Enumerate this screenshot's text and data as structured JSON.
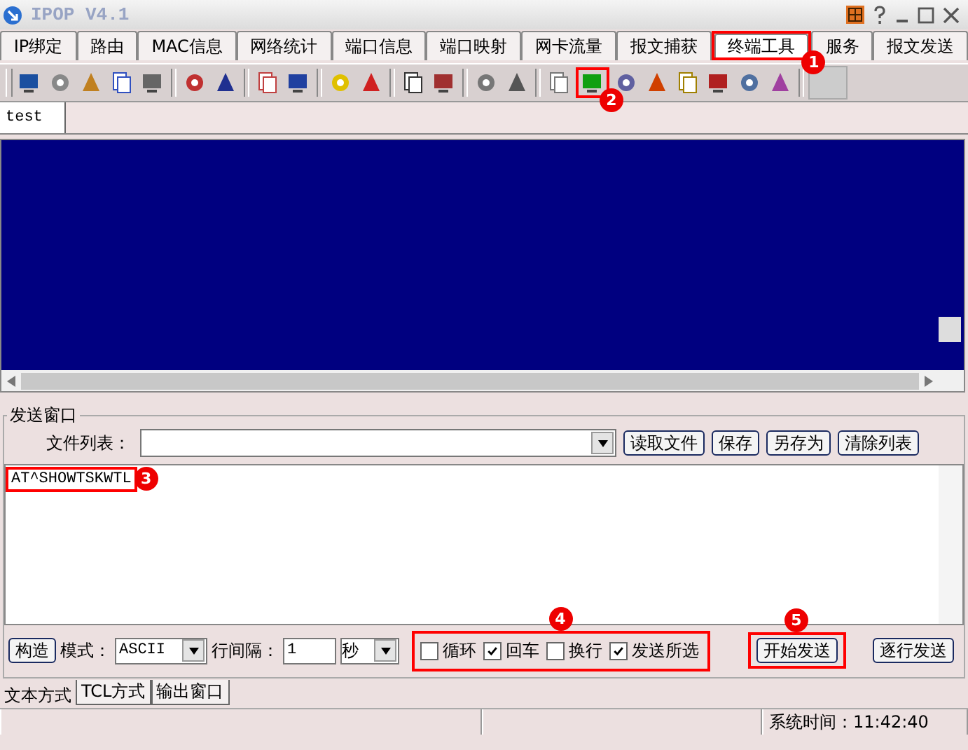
{
  "window": {
    "title": "IPOP V4.1"
  },
  "tabs": [
    {
      "label": "IP绑定",
      "selected": false
    },
    {
      "label": "路由",
      "selected": false
    },
    {
      "label": "MAC信息",
      "selected": false
    },
    {
      "label": "网络统计",
      "selected": false
    },
    {
      "label": "端口信息",
      "selected": false
    },
    {
      "label": "端口映射",
      "selected": false
    },
    {
      "label": "网卡流量",
      "selected": false
    },
    {
      "label": "报文捕获",
      "selected": false
    },
    {
      "label": "终端工具",
      "selected": true,
      "annotation": "1"
    },
    {
      "label": "服务",
      "selected": false
    },
    {
      "label": "报文发送",
      "selected": false
    }
  ],
  "toolbar": {
    "annotation": "2"
  },
  "document_tabs": [
    {
      "label": "test",
      "selected": true
    }
  ],
  "send_window": {
    "title": "发送窗口",
    "file_list_label": "文件列表：",
    "buttons": [
      "读取文件",
      "保存",
      "另存为",
      "清除列表"
    ],
    "text": "AT^SHOWTSKWTL",
    "text_annotation": "3"
  },
  "controls": {
    "build_button": "构造",
    "mode_label": "模式：",
    "mode_value": "ASCII",
    "interval_label": "行间隔：",
    "interval_value": "1",
    "unit_value": "秒",
    "checkboxes": [
      {
        "label": "循环",
        "checked": false
      },
      {
        "label": "回车",
        "checked": true
      },
      {
        "label": "换行",
        "checked": false
      },
      {
        "label": "发送所选",
        "checked": true
      }
    ],
    "checkboxes_annotation": "4",
    "start_button": "开始发送",
    "start_annotation": "5",
    "step_button": "逐行发送"
  },
  "bottom_tabs": [
    {
      "label": "文本方式",
      "selected": true
    },
    {
      "label": "TCL方式",
      "selected": false
    },
    {
      "label": "输出窗口",
      "selected": false
    }
  ],
  "status_bar": {
    "time_label": "系统时间：",
    "time": "11:42:40"
  }
}
